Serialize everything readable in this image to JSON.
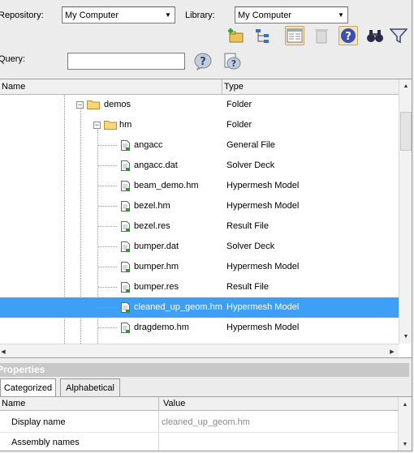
{
  "toolbar": {
    "repository_label": "Repository:",
    "repository_value": "My Computer",
    "library_label": "Library:",
    "library_value": "My Computer",
    "query_label": "Query:",
    "query_value": ""
  },
  "browser": {
    "columns": {
      "name": "Name",
      "type": "Type"
    },
    "rows": [
      {
        "name": "demos",
        "type": "Folder"
      },
      {
        "name": "hm",
        "type": "Folder"
      },
      {
        "name": "angacc",
        "type": "General File"
      },
      {
        "name": "angacc.dat",
        "type": "Solver Deck"
      },
      {
        "name": "beam_demo.hm",
        "type": "Hypermesh Model"
      },
      {
        "name": "bezel.hm",
        "type": "Hypermesh Model"
      },
      {
        "name": "bezel.res",
        "type": "Result File"
      },
      {
        "name": "bumper.dat",
        "type": "Solver Deck"
      },
      {
        "name": "bumper.hm",
        "type": "Hypermesh Model"
      },
      {
        "name": "bumper.res",
        "type": "Result File"
      },
      {
        "name": "cleaned_up_geom.hm",
        "type": "Hypermesh Model"
      },
      {
        "name": "dragdemo.hm",
        "type": "Hypermesh Model"
      }
    ],
    "selected_row": "cleaned_up_geom.hm"
  },
  "properties": {
    "title": "Properties",
    "tabs": [
      "Categorized",
      "Alphabetical"
    ],
    "columns": {
      "name": "Name",
      "value": "Value"
    },
    "rows": [
      {
        "name": "Display name",
        "value": "cleaned_up_geom.hm"
      },
      {
        "name": "Assembly names",
        "value": ""
      }
    ]
  },
  "colors": {
    "selection": "#3d9ff5",
    "accent_button": "#f3e2c0"
  }
}
